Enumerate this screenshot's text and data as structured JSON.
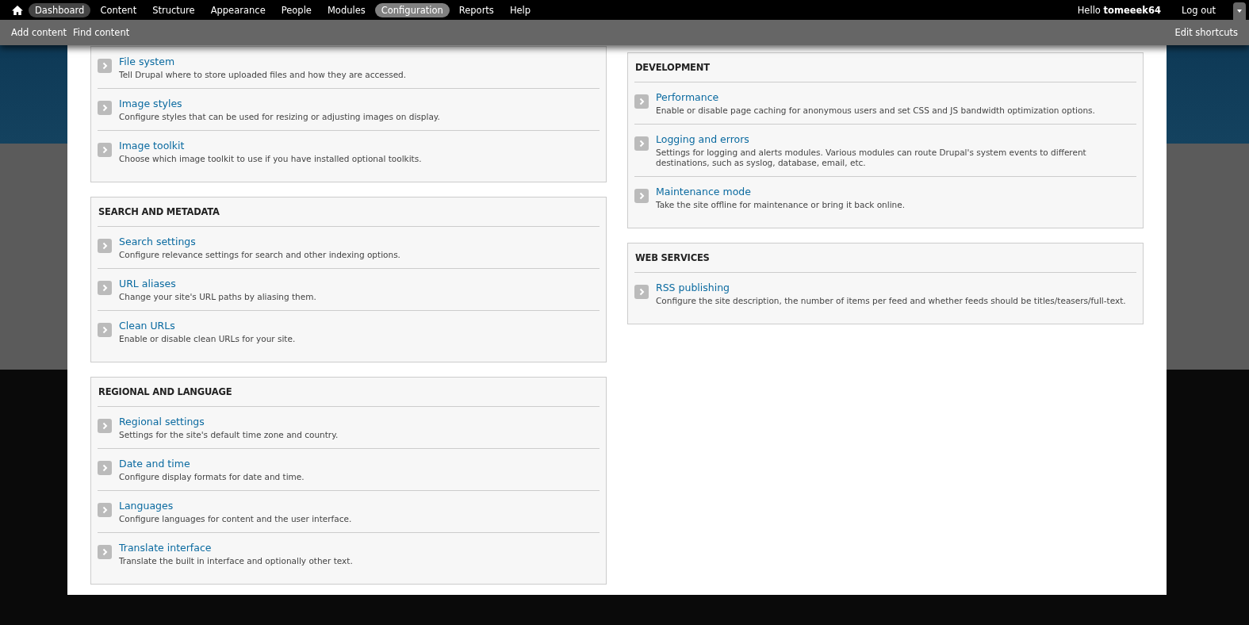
{
  "toolbar": {
    "menu": [
      {
        "label": "Dashboard",
        "selected": false,
        "hovered": true
      },
      {
        "label": "Content",
        "selected": false,
        "hovered": false
      },
      {
        "label": "Structure",
        "selected": false,
        "hovered": false
      },
      {
        "label": "Appearance",
        "selected": false,
        "hovered": false
      },
      {
        "label": "People",
        "selected": false,
        "hovered": false
      },
      {
        "label": "Modules",
        "selected": false,
        "hovered": false
      },
      {
        "label": "Configuration",
        "selected": true,
        "hovered": false
      },
      {
        "label": "Reports",
        "selected": false,
        "hovered": false
      },
      {
        "label": "Help",
        "selected": false,
        "hovered": false
      }
    ],
    "greeting": "Hello **tomeeek64**",
    "logout": "Log out"
  },
  "shortcuts": {
    "items": [
      "Add content",
      "Find content"
    ],
    "edit": "Edit shortcuts"
  },
  "columns": [
    [
      {
        "items": [
          {
            "title": "File system",
            "description": "Tell Drupal where to store uploaded files and how they are accessed."
          },
          {
            "title": "Image styles",
            "description": "Configure styles that can be used for resizing or adjusting images on display."
          },
          {
            "title": "Image toolkit",
            "description": "Choose which image toolkit to use if you have installed optional toolkits."
          }
        ]
      },
      {
        "heading": "SEARCH AND METADATA",
        "items": [
          {
            "title": "Search settings",
            "description": "Configure relevance settings for search and other indexing options."
          },
          {
            "title": "URL aliases",
            "description": "Change your site's URL paths by aliasing them."
          },
          {
            "title": "Clean URLs",
            "description": "Enable or disable clean URLs for your site."
          }
        ]
      },
      {
        "heading": "REGIONAL AND LANGUAGE",
        "items": [
          {
            "title": "Regional settings",
            "description": "Settings for the site's default time zone and country."
          },
          {
            "title": "Date and time",
            "description": "Configure display formats for date and time."
          },
          {
            "title": "Languages",
            "description": "Configure languages for content and the user interface."
          },
          {
            "title": "Translate interface",
            "description": "Translate the built in interface and optionally other text."
          }
        ]
      }
    ],
    [
      {
        "heading": "DEVELOPMENT",
        "items": [
          {
            "title": "Performance",
            "description": "Enable or disable page caching for anonymous users and set CSS and JS bandwidth optimization options."
          },
          {
            "title": "Logging and errors",
            "description": "Settings for logging and alerts modules. Various modules can route Drupal's system events to different destinations, such as syslog, database, email, etc."
          },
          {
            "title": "Maintenance mode",
            "description": "Take the site offline for maintenance or bring it back online."
          }
        ]
      },
      {
        "heading": "WEB SERVICES",
        "items": [
          {
            "title": "RSS publishing",
            "description": "Configure the site description, the number of items per feed and whether feeds should be titles/teasers/full-text."
          }
        ]
      }
    ]
  ]
}
